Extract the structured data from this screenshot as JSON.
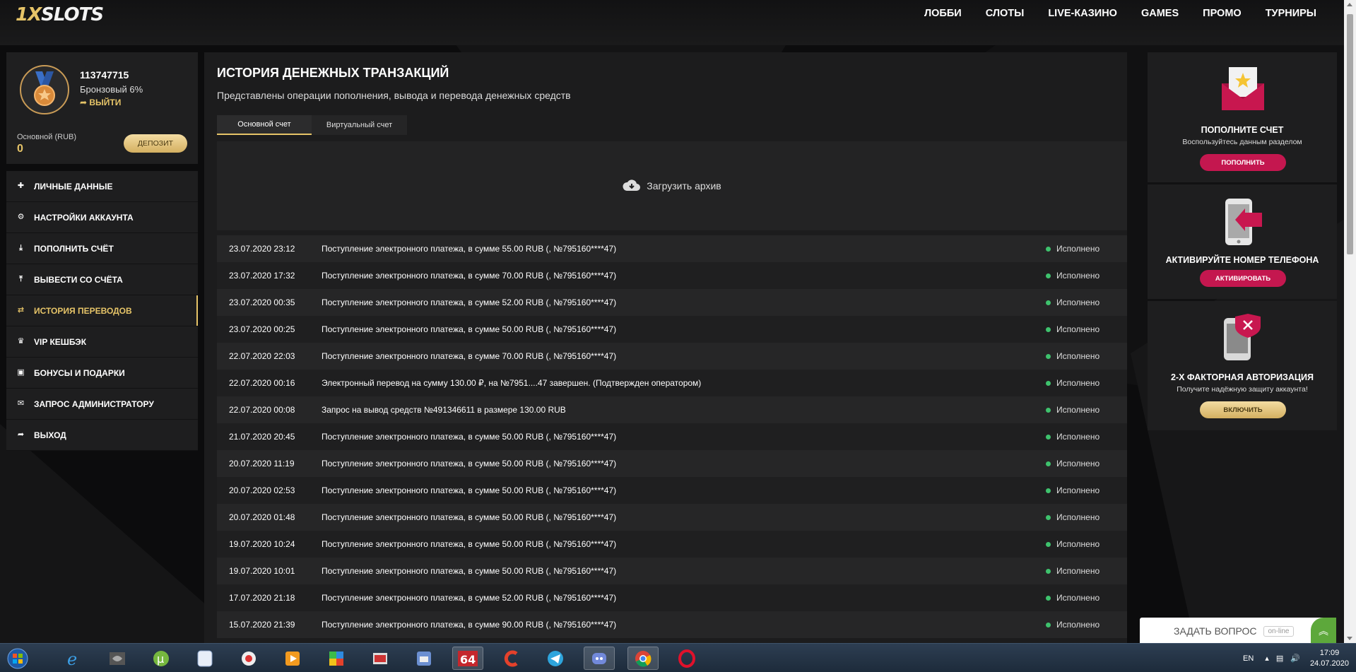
{
  "header": {
    "logo_x": "1X",
    "logo_rest": "SLOTS",
    "nav": [
      "ЛОББИ",
      "СЛОТЫ",
      "LIVE-КАЗИНО",
      "GAMES",
      "ПРОМО",
      "ТУРНИРЫ"
    ]
  },
  "profile": {
    "id": "113747715",
    "level": "Бронзовый 6%",
    "logout": "ВЫЙТИ",
    "account_label": "Основной (RUB)",
    "balance": "0",
    "deposit_label": "ДЕПОЗИТ"
  },
  "menu": [
    {
      "label": "ЛИЧНЫЕ ДАННЫЕ",
      "icon": "user-plus-icon",
      "active": false
    },
    {
      "label": "НАСТРОЙКИ АККАУНТА",
      "icon": "gears-icon",
      "active": false
    },
    {
      "label": "ПОПОЛНИТЬ СЧЁТ",
      "icon": "download-icon",
      "active": false
    },
    {
      "label": "ВЫВЕСТИ СО СЧЁТА",
      "icon": "upload-icon",
      "active": false
    },
    {
      "label": "ИСТОРИЯ ПЕРЕВОДОВ",
      "icon": "transfer-arrows-icon",
      "active": true
    },
    {
      "label": "VIP КЕШБЭК",
      "icon": "crown-icon",
      "active": false
    },
    {
      "label": "БОНУСЫ И ПОДАРКИ",
      "icon": "gift-icon",
      "active": false
    },
    {
      "label": "ЗАПРОС АДМИНИСТРАТОРУ",
      "icon": "envelope-icon",
      "active": false
    },
    {
      "label": "ВЫХОД",
      "icon": "sign-out-icon",
      "active": false
    }
  ],
  "main": {
    "title": "ИСТОРИЯ ДЕНЕЖНЫХ ТРАНЗАКЦИЙ",
    "subtitle": "Представлены операции пополнения, вывода и перевода денежных средств",
    "tabs": [
      "Основной счет",
      "Виртуальный счет"
    ],
    "archive_label": "Загрузить архив",
    "transactions": [
      {
        "date": "23.07.2020 23:12",
        "text": "Поступление электронного платежа, в сумме 55.00 RUB (, №795160****47)",
        "status": "Исполнено"
      },
      {
        "date": "23.07.2020 17:32",
        "text": "Поступление электронного платежа, в сумме 70.00 RUB (, №795160****47)",
        "status": "Исполнено"
      },
      {
        "date": "23.07.2020 00:35",
        "text": "Поступление электронного платежа, в сумме 52.00 RUB (, №795160****47)",
        "status": "Исполнено"
      },
      {
        "date": "23.07.2020 00:25",
        "text": "Поступление электронного платежа, в сумме 50.00 RUB (, №795160****47)",
        "status": "Исполнено"
      },
      {
        "date": "22.07.2020 22:03",
        "text": "Поступление электронного платежа, в сумме 70.00 RUB (, №795160****47)",
        "status": "Исполнено"
      },
      {
        "date": "22.07.2020 00:16",
        "text": "Электронный перевод на сумму 130.00 ₽, на №7951....47 завершен. (Подтвержден оператором)",
        "status": "Исполнено"
      },
      {
        "date": "22.07.2020 00:08",
        "text": "Запрос на вывод средств №491346611 в размере 130.00 RUB",
        "status": "Исполнено"
      },
      {
        "date": "21.07.2020 20:45",
        "text": "Поступление электронного платежа, в сумме 50.00 RUB (, №795160****47)",
        "status": "Исполнено"
      },
      {
        "date": "20.07.2020 11:19",
        "text": "Поступление электронного платежа, в сумме 50.00 RUB (, №795160****47)",
        "status": "Исполнено"
      },
      {
        "date": "20.07.2020 02:53",
        "text": "Поступление электронного платежа, в сумме 50.00 RUB (, №795160****47)",
        "status": "Исполнено"
      },
      {
        "date": "20.07.2020 01:48",
        "text": "Поступление электронного платежа, в сумме 50.00 RUB (, №795160****47)",
        "status": "Исполнено"
      },
      {
        "date": "19.07.2020 10:24",
        "text": "Поступление электронного платежа, в сумме 50.00 RUB (, №795160****47)",
        "status": "Исполнено"
      },
      {
        "date": "19.07.2020 10:01",
        "text": "Поступление электронного платежа, в сумме 50.00 RUB (, №795160****47)",
        "status": "Исполнено"
      },
      {
        "date": "17.07.2020 21:18",
        "text": "Поступление электронного платежа, в сумме 52.00 RUB (, №795160****47)",
        "status": "Исполнено"
      },
      {
        "date": "15.07.2020 21:39",
        "text": "Поступление электронного платежа, в сумме 90.00 RUB (, №795160****47)",
        "status": "Исполнено"
      }
    ]
  },
  "cards": {
    "deposit": {
      "title": "ПОПОЛНИТЕ СЧЕТ",
      "text": "Воспользуйтесь данным разделом",
      "button": "ПОПОЛНИТЬ"
    },
    "phone": {
      "title": "АКТИВИРУЙТЕ НОМЕР ТЕЛЕФОНА",
      "button": "АКТИВИРОВАТЬ"
    },
    "twofa": {
      "title": "2-Х ФАКТОРНАЯ АВТОРИЗАЦИЯ",
      "text": "Получите надёжную защиту аккаунта!",
      "button": "ВКЛЮЧИТЬ"
    }
  },
  "chat": {
    "label": "ЗАДАТЬ ВОПРОС",
    "status": "on-line"
  },
  "taskbar": {
    "icons": [
      "windows-start-icon",
      "internet-explorer-icon",
      "nvidia-icon",
      "utorrent-icon",
      "notes-app-icon",
      "camera-app-icon",
      "media-player-icon",
      "bluestacks-icon",
      "cash-app-icon",
      "flash-app-icon",
      "aida64-icon",
      "ccleaner-icon",
      "telegram-icon",
      "discord-icon",
      "chrome-icon",
      "opera-icon"
    ],
    "lang": "EN",
    "time": "17:09",
    "date": "24.07.2020"
  },
  "colors": {
    "accent": "#e6c468",
    "pink": "#c4174f",
    "status_ok": "#3ec26d"
  }
}
